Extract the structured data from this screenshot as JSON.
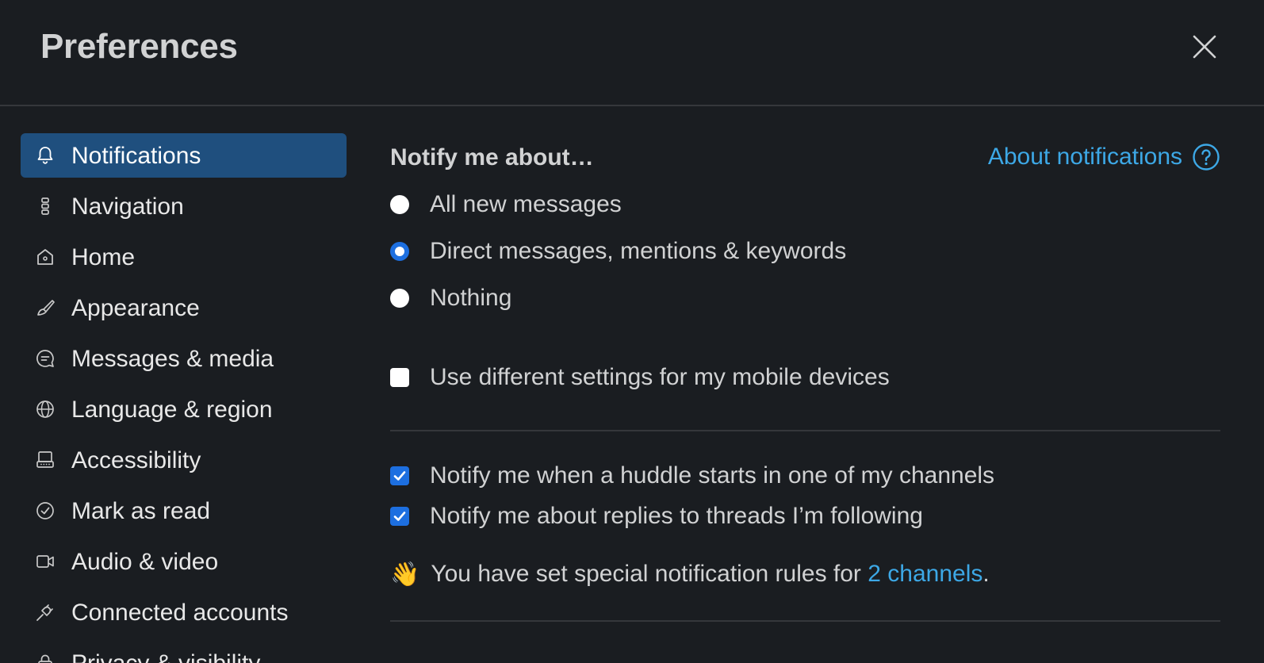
{
  "header": {
    "title": "Preferences"
  },
  "sidebar": {
    "items": [
      {
        "label": "Notifications",
        "icon": "bell-icon",
        "active": true
      },
      {
        "label": "Navigation",
        "icon": "navigation-icon"
      },
      {
        "label": "Home",
        "icon": "home-icon"
      },
      {
        "label": "Appearance",
        "icon": "paintbrush-icon"
      },
      {
        "label": "Messages & media",
        "icon": "message-bubble-icon"
      },
      {
        "label": "Language & region",
        "icon": "globe-icon"
      },
      {
        "label": "Accessibility",
        "icon": "keyboard-icon"
      },
      {
        "label": "Mark as read",
        "icon": "check-circle-icon"
      },
      {
        "label": "Audio & video",
        "icon": "video-camera-icon"
      },
      {
        "label": "Connected accounts",
        "icon": "plug-icon"
      },
      {
        "label": "Privacy & visibility",
        "icon": "lock-icon"
      }
    ]
  },
  "notifications": {
    "section_title": "Notify me about…",
    "about_link": "About notifications",
    "radio_options": [
      {
        "label": "All new messages",
        "checked": false
      },
      {
        "label": "Direct messages, mentions & keywords",
        "checked": true
      },
      {
        "label": "Nothing",
        "checked": false
      }
    ],
    "mobile_checkbox": {
      "label": "Use different settings for my mobile devices",
      "checked": false
    },
    "checkboxes": [
      {
        "label": "Notify me when a huddle starts in one of my channels",
        "checked": true
      },
      {
        "label": "Notify me about replies to threads I’m following",
        "checked": true
      }
    ],
    "special_rules": {
      "emoji": "👋",
      "prefix": "You have set special notification rules for",
      "link": "2 channels",
      "suffix": "."
    }
  },
  "colors": {
    "background": "#1a1d21",
    "active_nav": "#1f4f7e",
    "link": "#3da8e6",
    "accent": "#1d6fe0"
  }
}
